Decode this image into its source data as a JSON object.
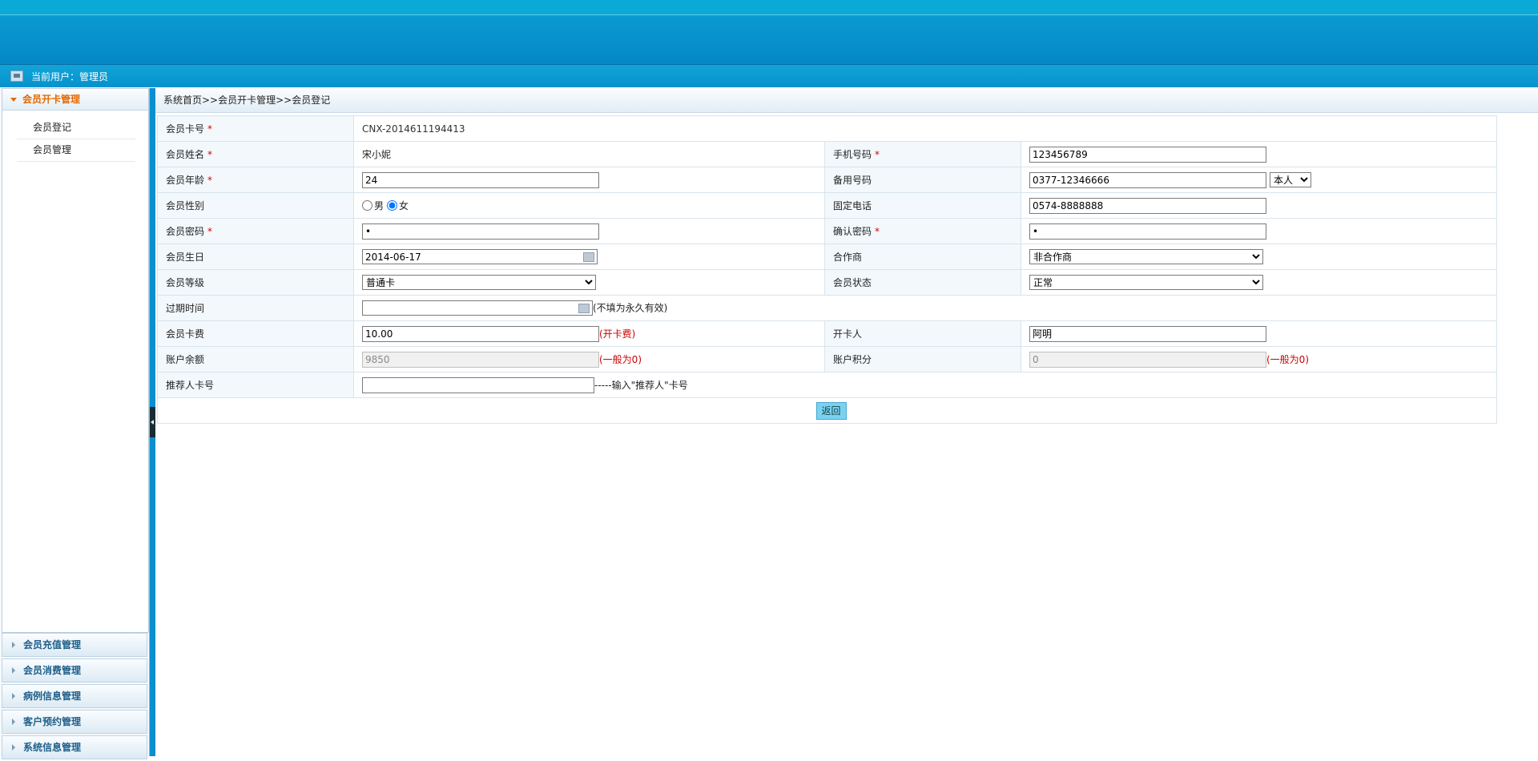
{
  "user_bar": {
    "label": "当前用户：管理员"
  },
  "sidebar": {
    "open_group": {
      "label": "会员开卡管理",
      "items": [
        "会员登记",
        "会员管理"
      ]
    },
    "groups": [
      "会员充值管理",
      "会员消费管理",
      "病例信息管理",
      "客户预约管理",
      "系统信息管理"
    ]
  },
  "breadcrumb": "系统首页>>会员开卡管理>>会员登记",
  "form": {
    "card_no": {
      "label": "会员卡号",
      "value": "CNX-2014611194413"
    },
    "name": {
      "label": "会员姓名",
      "value": "宋小妮"
    },
    "phone": {
      "label": "手机号码",
      "value": "123456789"
    },
    "age": {
      "label": "会员年龄",
      "value": "24"
    },
    "alt_phone": {
      "label": "备用号码",
      "value": "0377-12346666",
      "relation_selected": "本人"
    },
    "gender": {
      "label": "会员性别",
      "options": [
        "男",
        "女"
      ],
      "selected": "女"
    },
    "landline": {
      "label": "固定电话",
      "value": "0574-8888888"
    },
    "password": {
      "label": "会员密码",
      "value": "•"
    },
    "confirm_password": {
      "label": "确认密码",
      "value": "•"
    },
    "birthday": {
      "label": "会员生日",
      "value": "2014-06-17"
    },
    "partner": {
      "label": "合作商",
      "selected": "非合作商"
    },
    "level": {
      "label": "会员等级",
      "selected": "普通卡"
    },
    "status": {
      "label": "会员状态",
      "selected": "正常"
    },
    "expire": {
      "label": "过期时间",
      "value": "",
      "hint": "(不填为永久有效)"
    },
    "card_fee": {
      "label": "会员卡费",
      "value": "10.00",
      "hint": "(开卡费)"
    },
    "opener": {
      "label": "开卡人",
      "value": "阿明"
    },
    "balance": {
      "label": "账户余额",
      "value": "9850",
      "hint": "(一般为0)"
    },
    "points": {
      "label": "账户积分",
      "value": "0",
      "hint": "(一般为0)"
    },
    "referrer": {
      "label": "推荐人卡号",
      "value": "",
      "hint": "-----输入\"推荐人\"卡号"
    },
    "return_label": "返回"
  }
}
